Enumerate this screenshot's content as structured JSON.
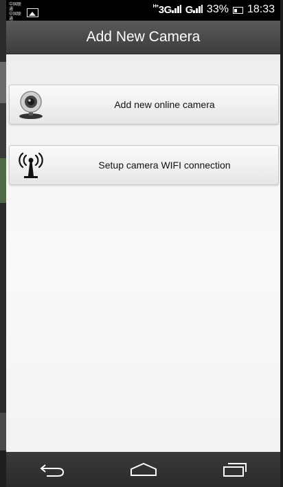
{
  "status_bar": {
    "carrier_line1": "中国联通",
    "carrier_line2": "中国联通",
    "network1": "3G",
    "network2": "G",
    "battery": "33%",
    "time": "18:33"
  },
  "header": {
    "title": "Add New Camera"
  },
  "actions": [
    {
      "label": "Add new online camera",
      "icon": "webcam-icon"
    },
    {
      "label": "Setup camera WIFI connection",
      "icon": "wifi-antenna-icon"
    }
  ],
  "nav": [
    "back-icon",
    "home-icon",
    "recent-apps-icon"
  ]
}
